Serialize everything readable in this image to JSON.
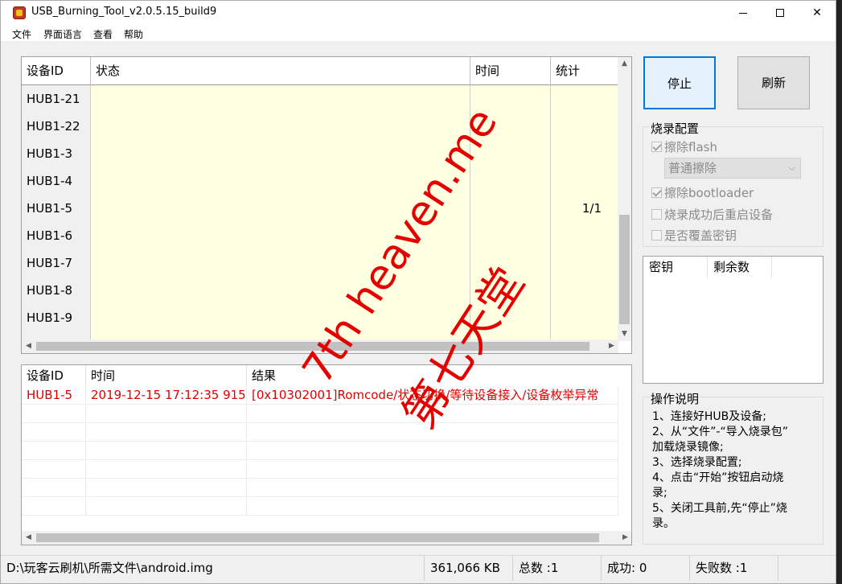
{
  "window": {
    "title": "USB_Burning_Tool_v2.0.5.15_build9"
  },
  "menu": [
    "文件",
    "界面语言",
    "查看",
    "帮助"
  ],
  "device_table": {
    "headers": [
      "设备ID",
      "状态",
      "时间",
      "统计"
    ],
    "rows": [
      {
        "id": "HUB1-21",
        "state": "",
        "time": "",
        "stat": ""
      },
      {
        "id": "HUB1-22",
        "state": "",
        "time": "",
        "stat": ""
      },
      {
        "id": "HUB1-3",
        "state": "",
        "time": "",
        "stat": ""
      },
      {
        "id": "HUB1-4",
        "state": "",
        "time": "",
        "stat": ""
      },
      {
        "id": "HUB1-5",
        "state": "",
        "time": "",
        "stat": "1/1"
      },
      {
        "id": "HUB1-6",
        "state": "",
        "time": "",
        "stat": ""
      },
      {
        "id": "HUB1-7",
        "state": "",
        "time": "",
        "stat": ""
      },
      {
        "id": "HUB1-8",
        "state": "",
        "time": "",
        "stat": ""
      },
      {
        "id": "HUB1-9",
        "state": "",
        "time": "",
        "stat": ""
      }
    ]
  },
  "log_table": {
    "headers": [
      "设备ID",
      "时间",
      "结果"
    ],
    "rows": [
      {
        "id": "HUB1-5",
        "time": "2019-12-15 17:12:35 915",
        "result": "[0x10302001]Romcode/状态切换/等待设备接入/设备枚举异常"
      }
    ]
  },
  "buttons": {
    "stop": "停止",
    "refresh": "刷新"
  },
  "burn_config": {
    "title": "烧录配置",
    "erase_flash": {
      "label": "擦除flash",
      "checked": true
    },
    "erase_mode": "普通擦除",
    "erase_bootloader": {
      "label": "擦除bootloader",
      "checked": true
    },
    "reboot_after": {
      "label": "烧录成功后重启设备",
      "checked": false
    },
    "overwrite_key": {
      "label": "是否覆盖密钥",
      "checked": false
    }
  },
  "key_list": {
    "headers": [
      "密钥",
      "剩余数"
    ]
  },
  "instructions": {
    "title": "操作说明",
    "lines": [
      "1、连接好HUB及设备;",
      "2、从“文件”-“导入烧录包”",
      "加载烧录镜像;",
      "3、选择烧录配置;",
      "4、点击“开始”按钮启动烧",
      "录;",
      "5、关闭工具前,先“停止”烧",
      "录。"
    ]
  },
  "status_bar": {
    "path": "D:\\玩客云刷机\\所需文件\\android.img",
    "size": "361,066 KB",
    "total": "总数 :1",
    "success": "成功: 0",
    "fail": "失败数 :1"
  },
  "watermark": {
    "line1": "7th heaven.me",
    "line2": "第七天堂"
  }
}
